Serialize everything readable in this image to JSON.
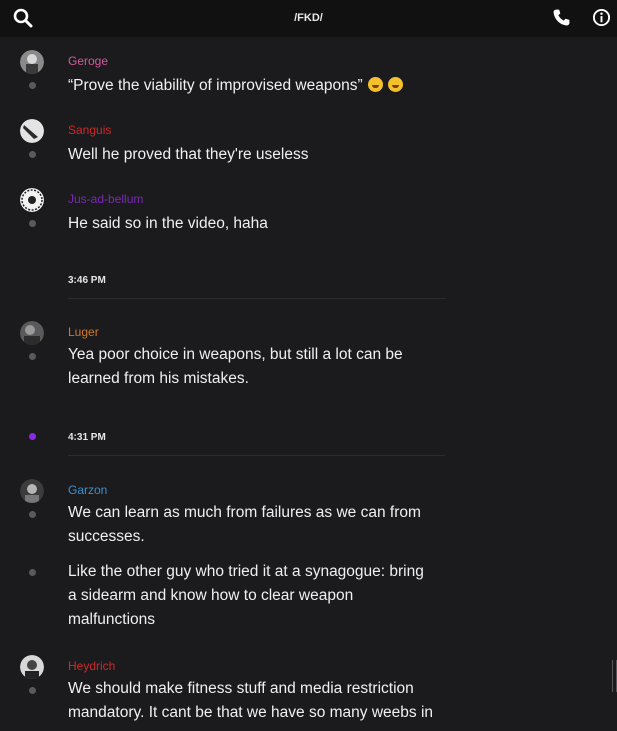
{
  "header": {
    "title": "/FKD/",
    "left_icon": "search-icon",
    "right_icons": [
      "phone-icon",
      "info-icon"
    ]
  },
  "messages": [
    {
      "author": "Geroge",
      "author_color": "#d05a9a",
      "lines": [
        "“Prove the viability of improvised weapons”"
      ],
      "emojis": [
        "rolling-on-floor-laughing-emoji",
        "rolling-on-floor-laughing-emoji"
      ]
    },
    {
      "author": "Sanguis",
      "author_color": "#cc2a2a",
      "lines": [
        "Well he proved that they're useless"
      ]
    },
    {
      "author": "Jus-ad-bellum",
      "author_color": "#7a2bb0",
      "lines": [
        "He said so in the video, haha"
      ]
    },
    {
      "author": "Luger",
      "author_color": "#d07a2b",
      "lines": [
        "Yea poor choice in weapons, but still a lot can be",
        "learned from his mistakes."
      ]
    },
    {
      "author": "Garzon",
      "author_color": "#3f8fcc",
      "lines": [
        "We can learn as much from failures as we can from",
        "successes."
      ]
    },
    {
      "author": "",
      "lines": [
        "Like the other guy who tried it at a synagogue: bring",
        "a sidearm and know how to clear weapon",
        "malfunctions"
      ]
    },
    {
      "author": "Heydrich",
      "author_color": "#cc2a2a",
      "lines": [
        "We should make fitness stuff and media restriction",
        "mandatory. It cant be that we have so many weebs in"
      ]
    }
  ],
  "timestamps": [
    "3:46 PM",
    "4:31 PM"
  ],
  "colors": {
    "background": "#1b1b1d",
    "topbar": "#111112",
    "unread_dot": "#8a2be2",
    "read_dot": "#5a5a5e"
  }
}
